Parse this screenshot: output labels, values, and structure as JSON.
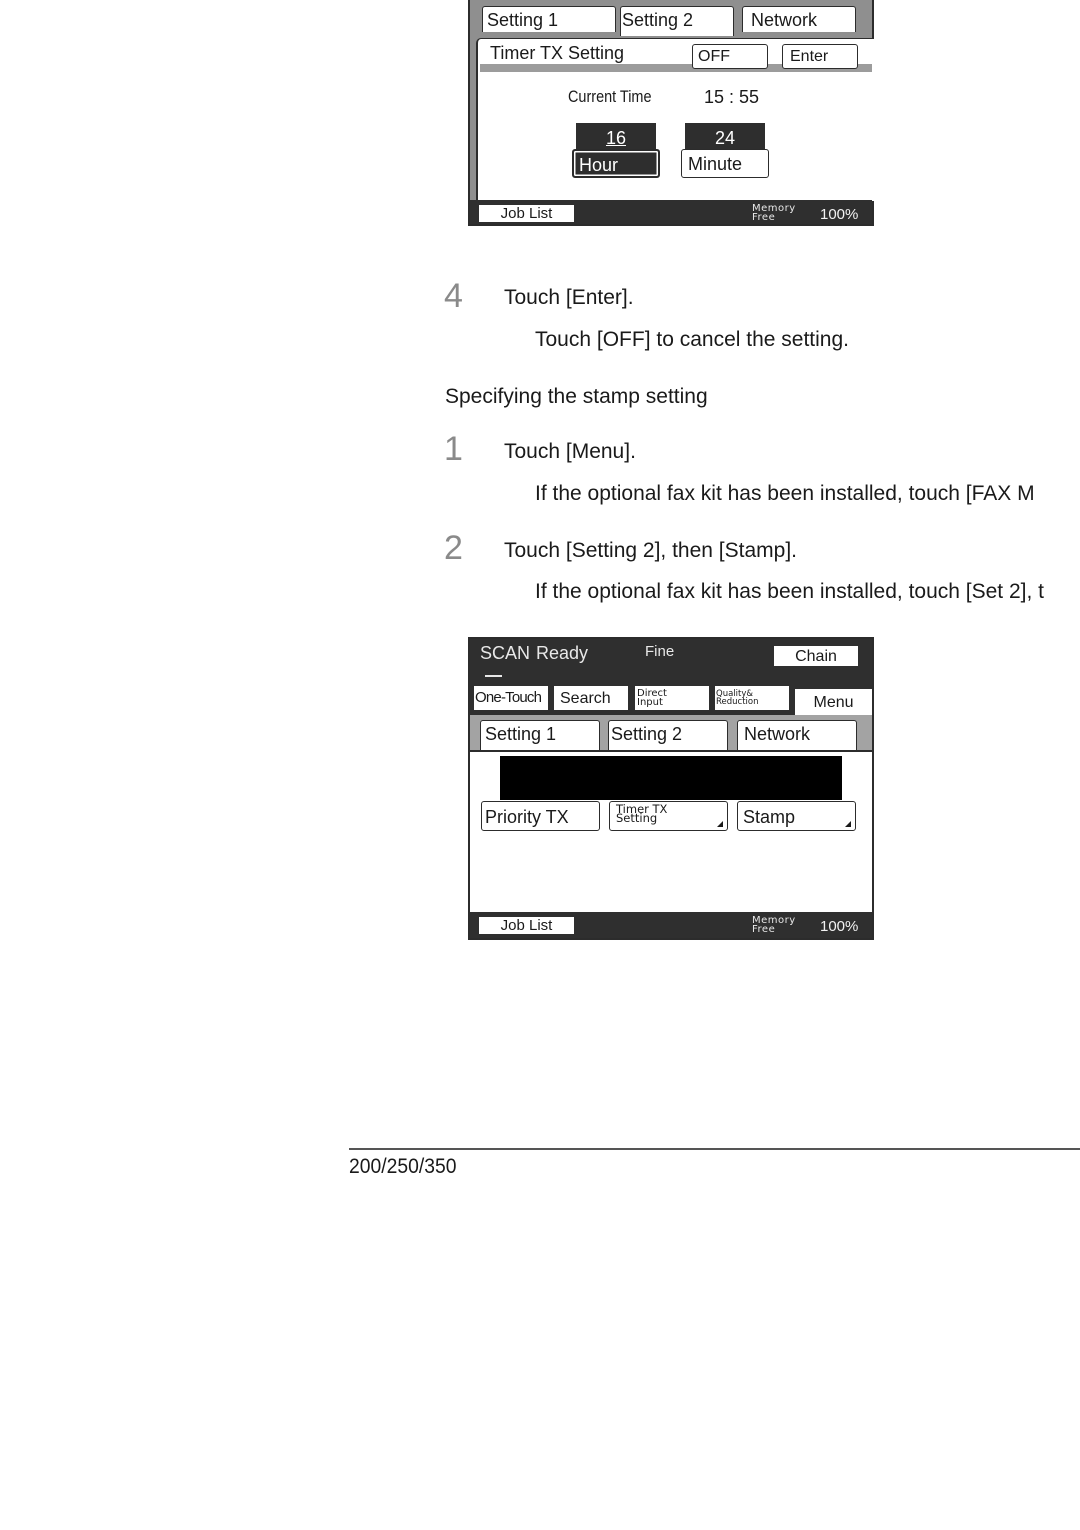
{
  "panel1": {
    "tabs": [
      "Setting 1",
      "Setting 2",
      "Network"
    ],
    "active_tab": "Setting 2",
    "dialog_title": "Timer TX Setting",
    "off_label": "OFF",
    "enter_label": "Enter",
    "current_time_label": "Current Time",
    "current_time_value": "15 : 55",
    "hour_value": "16",
    "minute_value": "24",
    "hour_label": "Hour",
    "minute_label": "Minute",
    "job_list_label": "Job List",
    "memory_label_1": "Memory",
    "memory_label_2": "Free",
    "memory_value": "100%"
  },
  "steps_a": [
    {
      "number": "4",
      "text": "Touch [Enter].",
      "sub": "Touch [OFF] to cancel the setting."
    }
  ],
  "section_title": "Specifying the stamp setting",
  "steps_b": [
    {
      "number": "1",
      "text": "Touch [Menu].",
      "sub": "If the optional fax kit has been installed, touch [FAX M"
    },
    {
      "number": "2",
      "text": "Touch [Setting 2], then [Stamp].",
      "sub": "If the optional fax kit has been installed, touch [Set 2], t"
    }
  ],
  "panel2": {
    "status_mode": "SCAN",
    "status_text": "Ready",
    "quality": "Fine",
    "chain_label": "Chain",
    "top_buttons": [
      "One-Touch",
      "Search",
      "Direct Input",
      "Quality& Reduction",
      "Menu"
    ],
    "direct_line1": "Direct",
    "direct_line2": "Input",
    "quality_line1": "Quality&",
    "quality_line2": "Reduction",
    "tabs": [
      "Setting 1",
      "Setting 2",
      "Network"
    ],
    "active_tab": "Setting 2",
    "function_buttons": [
      "Priority TX",
      "Timer TX Setting",
      "Stamp"
    ],
    "timer_line1": "Timer TX",
    "timer_line2": "Setting",
    "job_list_label": "Job List",
    "memory_label_1": "Memory",
    "memory_label_2": "Free",
    "memory_value": "100%"
  },
  "footer": {
    "model": "200/250/350"
  }
}
